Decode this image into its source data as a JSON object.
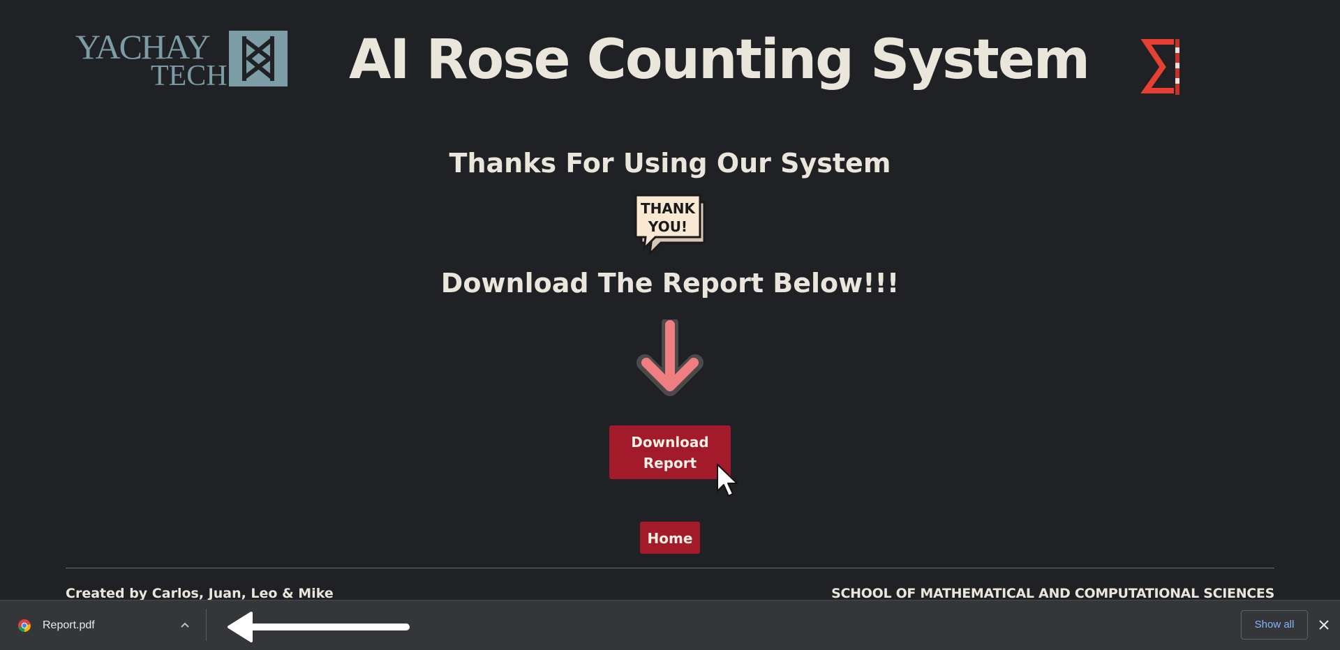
{
  "header": {
    "logo_left": {
      "line1": "YACHAY",
      "line2": "TECH",
      "color": "#7c9ca6"
    },
    "title": "AI Rose Counting System",
    "logo_right": {
      "icon": "sigma-logo-icon",
      "color": "#e64032"
    }
  },
  "main": {
    "thanks_heading": "Thanks For Using Our System",
    "thank_badge": {
      "line1": "THANK",
      "line2": "YOU!",
      "icon": "speech-bubble-icon"
    },
    "download_heading": "Download The Report Below!!!",
    "arrow_icon": "down-arrow-icon",
    "download_button": {
      "line1": "Download",
      "line2": "Report"
    },
    "home_button": "Home",
    "accent_color": "#a31b2b"
  },
  "footer": {
    "credits": "Created by Carlos, Juan, Leo & Mike",
    "school": "SCHOOL OF MATHEMATICAL AND COMPUTATIONAL SCIENCES"
  },
  "download_bar": {
    "file_name": "Report.pdf",
    "show_all_label": "Show all",
    "close_icon": "close-icon",
    "chevron_icon": "chevron-up-icon",
    "browser_icon": "chrome-icon",
    "link_color": "#8ab4f8"
  }
}
